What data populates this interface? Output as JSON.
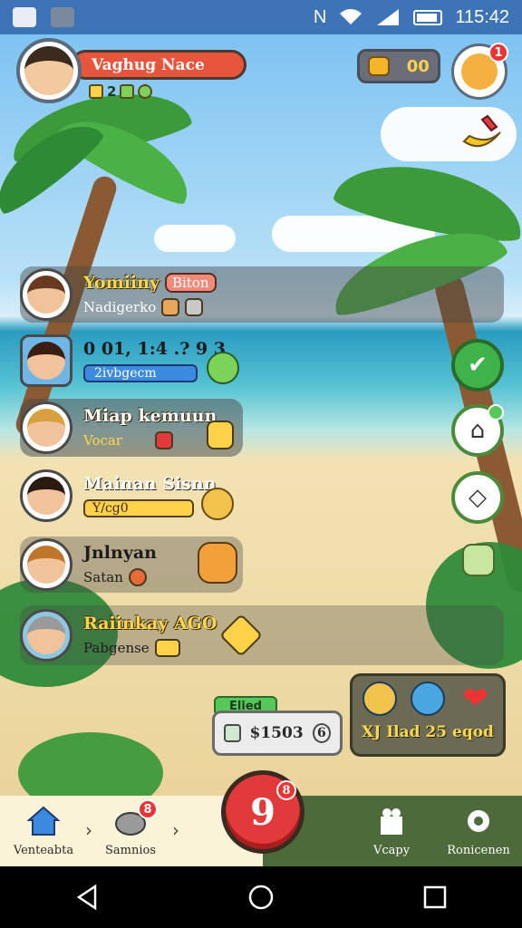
{
  "status_bar": {
    "time": "115:42",
    "icons": [
      "app-icon",
      "wand-icon",
      "nfc-icon",
      "wifi-icon",
      "signal-icon",
      "battery-icon"
    ]
  },
  "header": {
    "player_name": "Vaghug Nace",
    "stats": {
      "level": "2",
      "extra": ""
    },
    "coins": "00",
    "pet_badge": "1"
  },
  "friends": [
    {
      "name": "Yomiiny",
      "tag": "Biton",
      "sub": "Nadigerko"
    },
    {
      "name": "0 01, 1:4 .? 9 3",
      "sub": "2ivbgecm"
    },
    {
      "name": "Miap kemuun",
      "sub": "Vocar"
    },
    {
      "name": "Mainan Sisnn",
      "sub": "Y/cg0"
    },
    {
      "name": "Jnlnyan",
      "sub": "Satan"
    },
    {
      "name": "Raiinkay AGO",
      "sub": "Pabgense"
    }
  ],
  "elite": {
    "label": "Elied",
    "price": "$1503",
    "aux": "6"
  },
  "reward": {
    "text": "XJ Ilad 25 eqod"
  },
  "bottom_nav": {
    "items": [
      {
        "label": "Venteabta",
        "icon": "home-icon"
      },
      {
        "label": "Samnios",
        "icon": "friends-icon",
        "badge": "8"
      },
      {
        "label": "Vcapy",
        "icon": "gift-icon"
      },
      {
        "label": "Ronicenen",
        "icon": "gear-icon"
      }
    ],
    "play_label": "9",
    "play_badge": "8"
  },
  "colors": {
    "accent_red": "#e23a3a",
    "nav_green": "#4c6a3a",
    "name_yellow": "#ffd84a"
  }
}
